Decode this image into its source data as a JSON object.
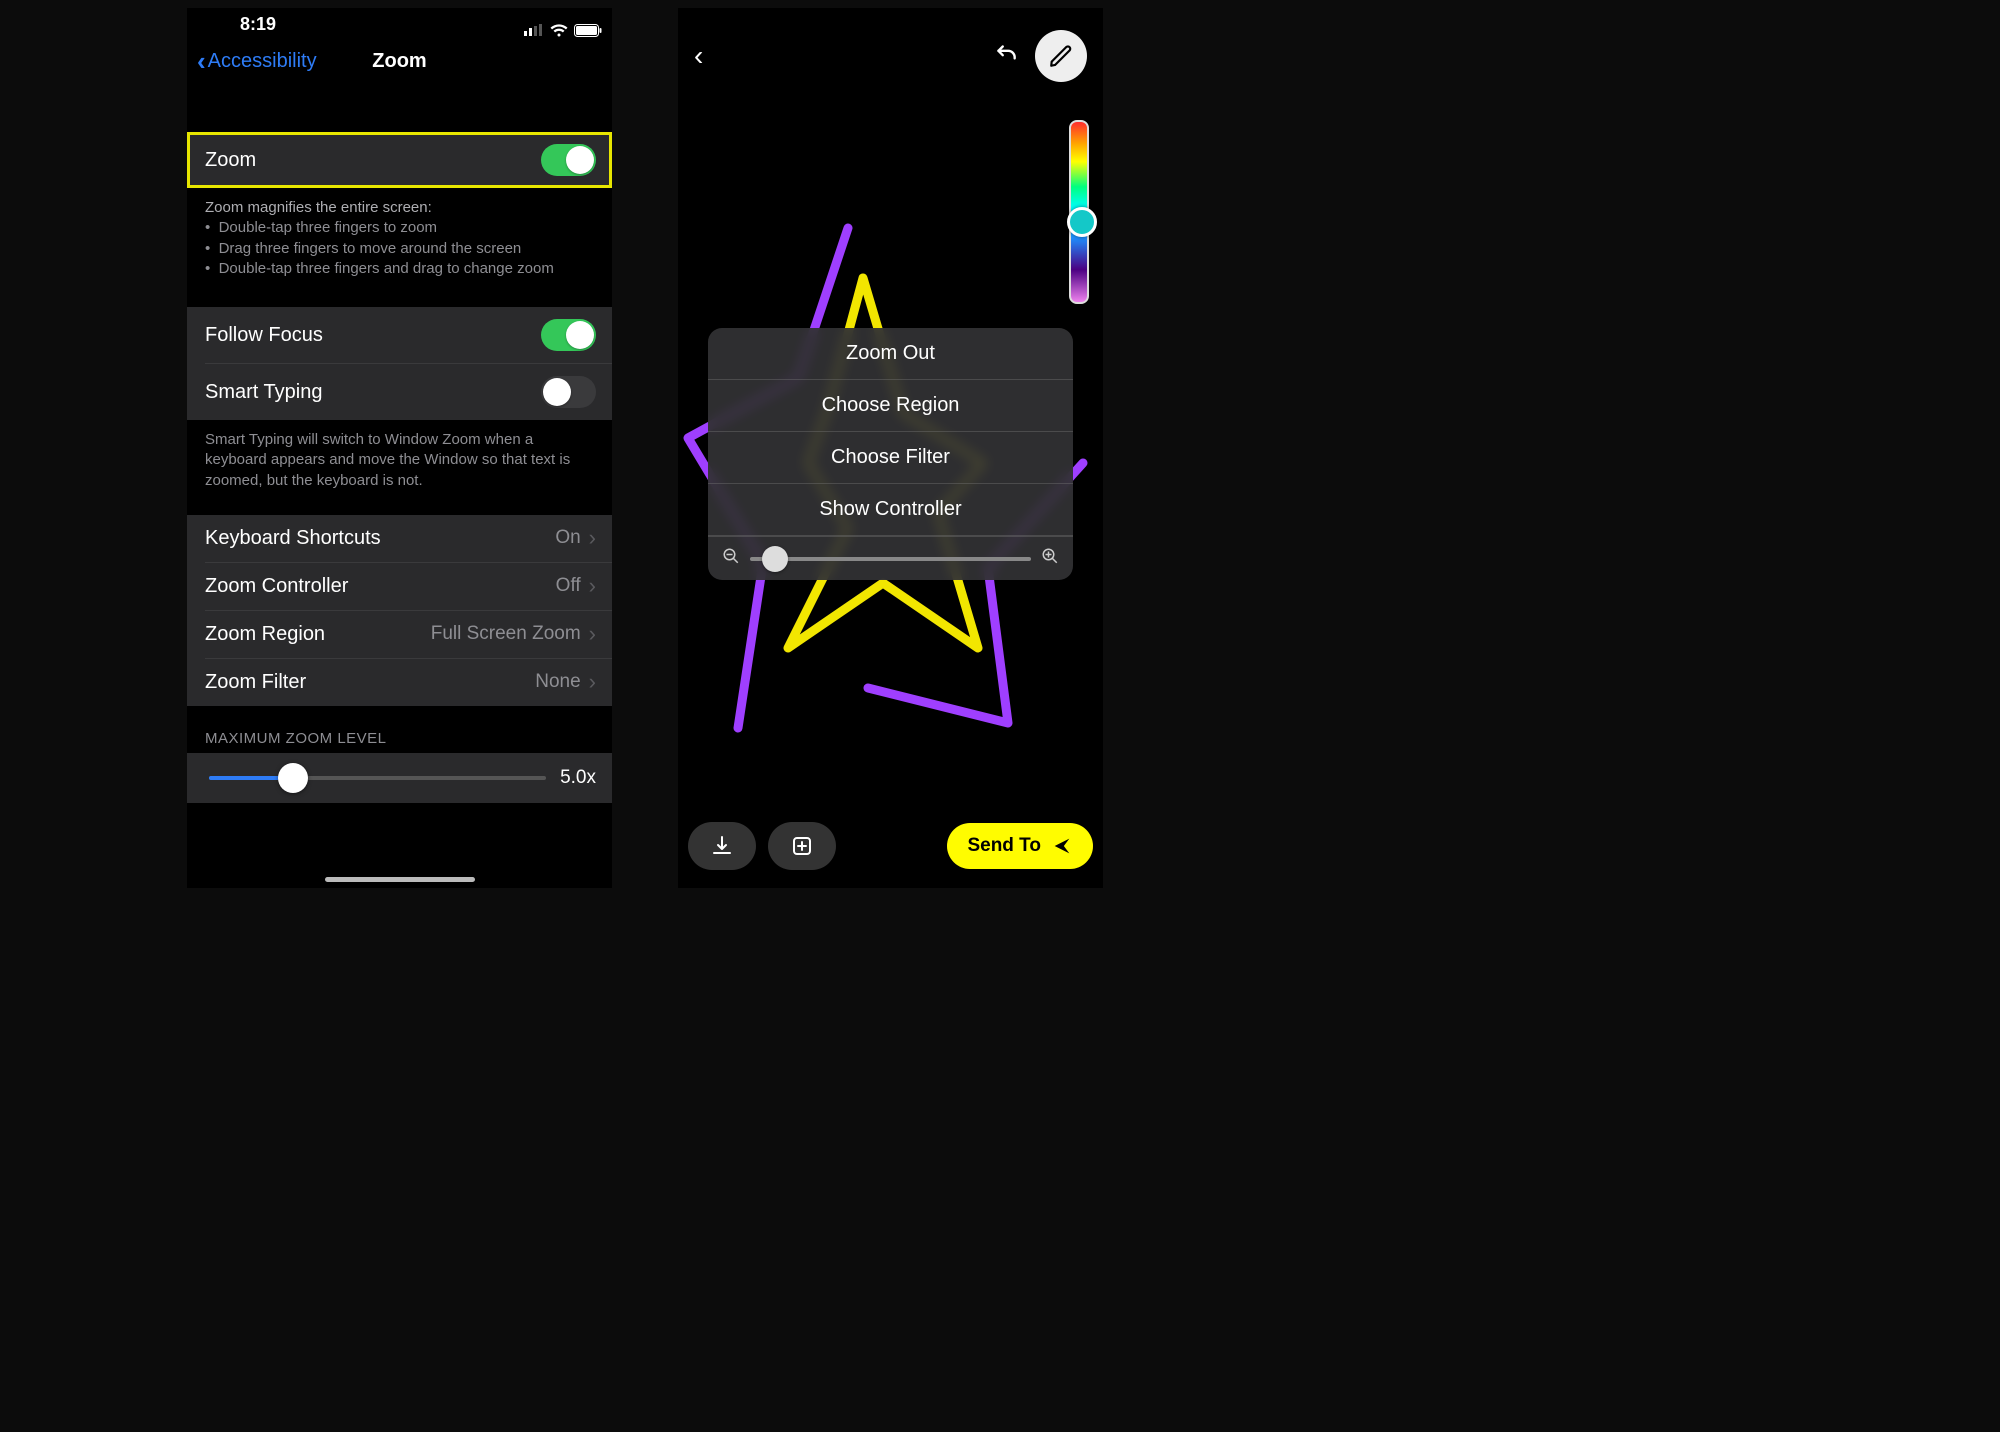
{
  "left": {
    "status": {
      "time": "8:19"
    },
    "nav": {
      "back": "Accessibility",
      "title": "Zoom"
    },
    "zoom_row": {
      "label": "Zoom",
      "on": true
    },
    "help": {
      "header": "Zoom magnifies the entire screen:",
      "b1": "Double-tap three fingers to zoom",
      "b2": "Drag three fingers to move around the screen",
      "b3": "Double-tap three fingers and drag to change zoom"
    },
    "follow_focus": {
      "label": "Follow Focus",
      "on": true
    },
    "smart_typing": {
      "label": "Smart Typing",
      "on": false
    },
    "smart_typing_note": "Smart Typing will switch to Window Zoom when a keyboard appears and move the Window so that text is zoomed, but the keyboard is not.",
    "kb_shortcuts": {
      "label": "Keyboard Shortcuts",
      "value": "On"
    },
    "zoom_controller": {
      "label": "Zoom Controller",
      "value": "Off"
    },
    "zoom_region": {
      "label": "Zoom Region",
      "value": "Full Screen Zoom"
    },
    "zoom_filter": {
      "label": "Zoom Filter",
      "value": "None"
    },
    "max_zoom": {
      "header": "MAXIMUM ZOOM LEVEL",
      "value_label": "5.0x",
      "percent": 25
    }
  },
  "right": {
    "menu": {
      "zoom_out": "Zoom Out",
      "choose_region": "Choose Region",
      "choose_filter": "Choose Filter",
      "show_controller": "Show Controller",
      "slider_percent": 10
    },
    "send_to": "Send To"
  }
}
